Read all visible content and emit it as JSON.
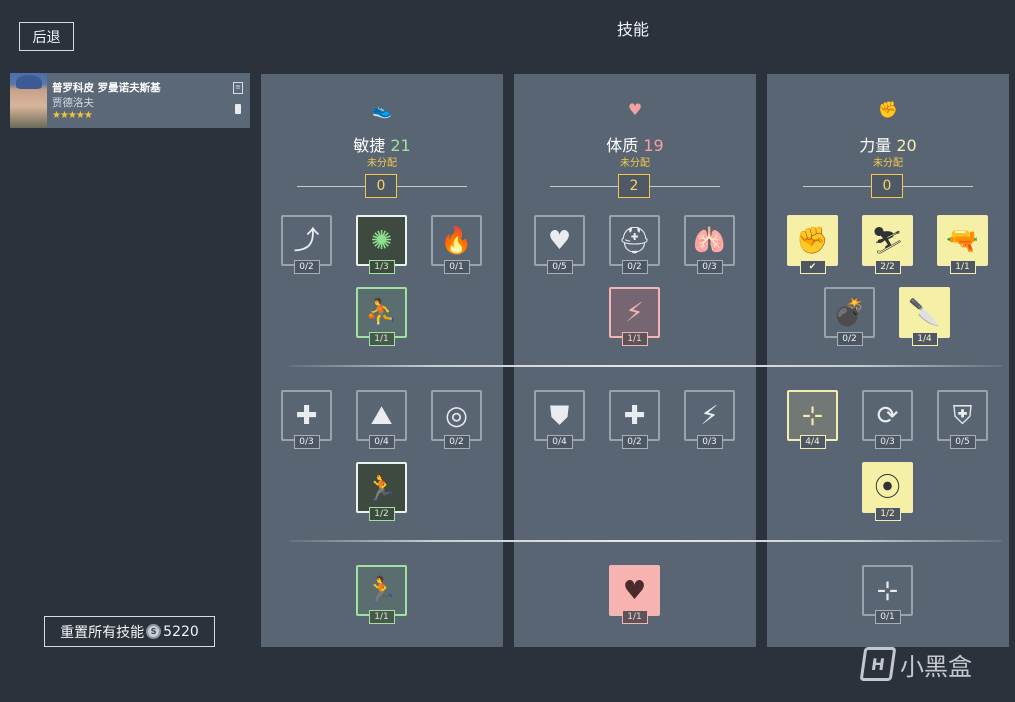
{
  "header": {
    "back_label": "后退",
    "title": "技能"
  },
  "character": {
    "name": "普罗科皮 罗曼诺夫斯基",
    "subtitle": "贾德洛夫",
    "stars": "★★★★★",
    "icons": [
      "list-icon",
      "battery-icon"
    ]
  },
  "reset": {
    "label": "重置所有技能",
    "cost": "5220",
    "icon": "coin-icon"
  },
  "columns": [
    {
      "name": "敏捷",
      "level": "21",
      "level_color": "#9fe29f",
      "icon": "running-shoe-icon",
      "icon_glyph": "👟",
      "unallocated_label": "未分配",
      "points": "0"
    },
    {
      "name": "体质",
      "level": "19",
      "level_color": "#f3a0a0",
      "icon": "heartbeat-icon",
      "icon_glyph": "♥",
      "unallocated_label": "未分配",
      "points": "2"
    },
    {
      "name": "力量",
      "level": "20",
      "level_color": "#f5ecb0",
      "icon": "fist-icon",
      "icon_glyph": "✊",
      "unallocated_label": "未分配",
      "points": "0"
    }
  ],
  "skills": {
    "agility": [
      {
        "count": "0/2",
        "icon": "dodge-icon",
        "glyph": "⤴",
        "state": "gray"
      },
      {
        "count": "1/3",
        "icon": "crawl-barbed-wire-icon",
        "glyph": "✺",
        "state": "green"
      },
      {
        "count": "0/1",
        "icon": "fire-icon",
        "glyph": "🔥",
        "state": "gray"
      },
      {
        "count": "1/1",
        "icon": "crouch-stance-icon",
        "glyph": "⛹",
        "state": "greenlite"
      },
      {
        "count": "0/3",
        "icon": "heal-speed-icon",
        "glyph": "✚",
        "state": "gray"
      },
      {
        "count": "0/4",
        "icon": "climb-icon",
        "glyph": "⛰",
        "state": "gray"
      },
      {
        "count": "0/2",
        "icon": "landing-icon",
        "glyph": "◎",
        "state": "gray"
      },
      {
        "count": "1/2",
        "icon": "sprint-icon",
        "glyph": "🏃",
        "state": "green"
      },
      {
        "count": "1/1",
        "icon": "dash-icon",
        "glyph": "🏃",
        "state": "greenlite"
      }
    ],
    "constitution": [
      {
        "count": "0/5",
        "icon": "heart-regen-icon",
        "glyph": "♥",
        "state": "gray"
      },
      {
        "count": "0/2",
        "icon": "helmet-icon",
        "glyph": "⛑",
        "state": "gray"
      },
      {
        "count": "0/3",
        "icon": "lungs-icon",
        "glyph": "🫁",
        "state": "gray"
      },
      {
        "count": "1/1",
        "icon": "energy-cycle-icon",
        "glyph": "⚡",
        "state": "pinkline"
      },
      {
        "count": "0/4",
        "icon": "armor-shield-icon",
        "glyph": "⛊",
        "state": "gray"
      },
      {
        "count": "0/2",
        "icon": "health-boost-icon",
        "glyph": "✚",
        "state": "gray"
      },
      {
        "count": "0/3",
        "icon": "stamina-boost-icon",
        "glyph": "⚡",
        "state": "gray"
      },
      {
        "count": "1/1",
        "icon": "heart-upgrade-icon",
        "glyph": "♥",
        "state": "pink"
      }
    ],
    "strength": [
      {
        "count": "✔",
        "icon": "fist-icon",
        "glyph": "✊",
        "state": "yellow"
      },
      {
        "count": "2/2",
        "icon": "carry-icon",
        "glyph": "⛷",
        "state": "yellow"
      },
      {
        "count": "1/1",
        "icon": "pistol-icon",
        "glyph": "🔫",
        "state": "yellow"
      },
      {
        "count": "0/2",
        "icon": "grenade-icon",
        "glyph": "💣",
        "state": "gray"
      },
      {
        "count": "1/4",
        "icon": "knife-icon",
        "glyph": "🔪",
        "state": "yellow"
      },
      {
        "count": "4/4",
        "icon": "aim-focus-icon",
        "glyph": "⊹",
        "state": "yellowline"
      },
      {
        "count": "0/3",
        "icon": "reload-icon",
        "glyph": "⟳",
        "state": "gray"
      },
      {
        "count": "0/5",
        "icon": "armor-plus-icon",
        "glyph": "⛨",
        "state": "gray"
      },
      {
        "count": "1/2",
        "icon": "ammo-cycle-icon",
        "glyph": "⦿",
        "state": "yellow"
      },
      {
        "count": "0/1",
        "icon": "target-focus-icon",
        "glyph": "⊹",
        "state": "gray"
      }
    ]
  },
  "watermark": {
    "text": "小黑盒",
    "icon": "xiaoheihe-logo-icon"
  }
}
